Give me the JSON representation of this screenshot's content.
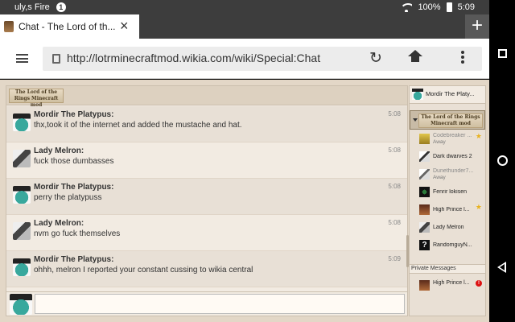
{
  "status_bar": {
    "carrier": "uly,s Fire",
    "notification_count": "1",
    "battery": "100%",
    "time": "5:09"
  },
  "browser": {
    "tab_title": "Chat - The Lord of th...",
    "url": "http://lotrminecraftmod.wikia.com/wiki/Special:Chat"
  },
  "chat": {
    "logo_text": "The Lord of the Rings Minecraft mod",
    "messages": [
      {
        "user": "Mordir The Platypus:",
        "text": "thx,took it of the internet and added the mustache and hat.",
        "time": "5:08",
        "avatar": "platypus"
      },
      {
        "user": "Lady Melron:",
        "text": "fuck those dumbasses",
        "time": "5:08",
        "avatar": "melron"
      },
      {
        "user": "Mordir The Platypus:",
        "text": "perry the platypuss",
        "time": "5:08",
        "avatar": "platypus"
      },
      {
        "user": "Lady Melron:",
        "text": "nvm go fuck themselves",
        "time": "5:08",
        "avatar": "melron"
      },
      {
        "user": "Mordir The Platypus:",
        "text": "ohhh, melron I reported your constant cussing to wikia central",
        "time": "5:09",
        "avatar": "platypus"
      }
    ],
    "input_value": ""
  },
  "sidebar": {
    "self_user": "Mordir The Platy...",
    "room_logo_text": "The Lord of the Rings Minecraft mod",
    "users": [
      {
        "name": "Codebreaker ...",
        "status": "Away",
        "away": true,
        "star": true,
        "avatar": "codebreaker"
      },
      {
        "name": "Dark dwarves 2",
        "status": "",
        "away": false,
        "star": false,
        "avatar": "dwarves"
      },
      {
        "name": "Dunethunder7...",
        "status": "Away",
        "away": true,
        "star": false,
        "avatar": "dune"
      },
      {
        "name": "Fenrir lokisen",
        "status": "",
        "away": false,
        "star": false,
        "avatar": "fenrir"
      },
      {
        "name": "High Prince l...",
        "status": "",
        "away": false,
        "star": true,
        "avatar": "highprince"
      },
      {
        "name": "Lady Melron",
        "status": "",
        "away": false,
        "star": false,
        "avatar": "melron"
      },
      {
        "name": "RandomguyN...",
        "status": "",
        "away": false,
        "star": false,
        "avatar": "random"
      }
    ],
    "private_messages_label": "Private Messages",
    "pm_user": "High Prince l...",
    "pm_badge": "!"
  },
  "icons": {
    "star_color": "#e8b21f",
    "badge_color": "#dd1111"
  }
}
